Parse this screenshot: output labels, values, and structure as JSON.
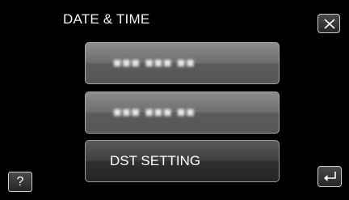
{
  "header": {
    "title": "DATE & TIME",
    "close_icon": "close-icon"
  },
  "menu": {
    "items": [
      {
        "label": "■■■ ■■■ ■■",
        "icon": "",
        "note": ""
      },
      {
        "label": "■■■ ■■■ ■■",
        "icon": "",
        "note": ""
      },
      {
        "label": "DST SETTING",
        "icon": "",
        "note": ""
      }
    ]
  },
  "footer": {
    "help_label": "?",
    "back_icon": "back-arrow-icon"
  },
  "colors": {
    "background": "#000000",
    "button_gray": "#7a7a7a",
    "button_dark": "#333333",
    "border": "#a8a8a8",
    "text": "#ffffff"
  }
}
